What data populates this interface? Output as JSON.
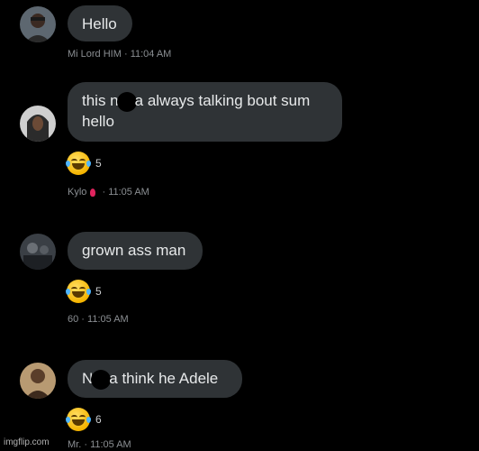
{
  "messages": [
    {
      "text": "Hello",
      "sender": "Mi Lord HIM",
      "time": "11:04 AM",
      "avatar": "avatar-1"
    },
    {
      "text_line1_a": "this n",
      "text_line1_b": "a always talking bout sum",
      "text_line2": "hello",
      "sender": "Kylo",
      "time": "11:05 AM",
      "reaction_emoji": "face-with-tears-of-joy",
      "reaction_count": "5",
      "avatar": "avatar-2"
    },
    {
      "text": "grown ass man",
      "sender": "60",
      "time": "11:05 AM",
      "reaction_emoji": "face-with-tears-of-joy",
      "reaction_count": "5",
      "avatar": "avatar-3"
    },
    {
      "text_a": "N",
      "text_b": "a think he Adele",
      "sender": "Mr.",
      "time": "11:05 AM",
      "reaction_emoji": "face-with-tears-of-joy",
      "reaction_count": "6",
      "avatar": "avatar-4"
    }
  ],
  "meta_separator": " · ",
  "watermark": "imgflip.com",
  "colors": {
    "background": "#000000",
    "bubble": "#2f3336",
    "text": "#e7e9ea",
    "meta": "#8b8f93"
  }
}
